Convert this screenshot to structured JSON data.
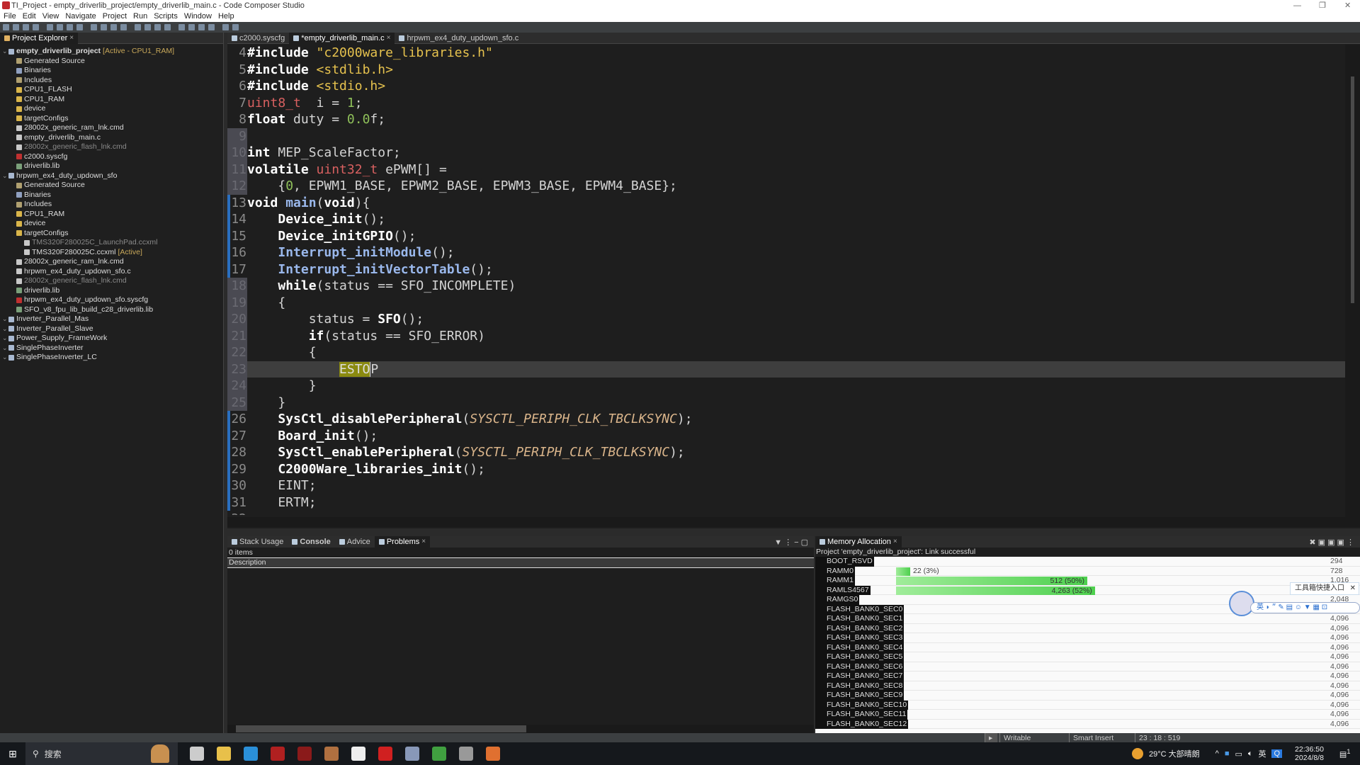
{
  "window": {
    "title": "TI_Project - empty_driverlib_project/empty_driverlib_main.c - Code Composer Studio"
  },
  "menu": [
    "File",
    "Edit",
    "View",
    "Navigate",
    "Project",
    "Run",
    "Scripts",
    "Window",
    "Help"
  ],
  "explorer": {
    "tab": "Project Explorer",
    "items": [
      {
        "label": "empty_driverlib_project",
        "lvl": 0,
        "icon": "proj",
        "active": "[Active - CPU1_RAM]",
        "bold": true
      },
      {
        "label": "Generated Source",
        "lvl": 1,
        "icon": "gen"
      },
      {
        "label": "Binaries",
        "lvl": 1,
        "icon": "bin"
      },
      {
        "label": "Includes",
        "lvl": 1,
        "icon": "gen"
      },
      {
        "label": "CPU1_FLASH",
        "lvl": 1,
        "icon": "folder"
      },
      {
        "label": "CPU1_RAM",
        "lvl": 1,
        "icon": "folder"
      },
      {
        "label": "device",
        "lvl": 1,
        "icon": "folder"
      },
      {
        "label": "targetConfigs",
        "lvl": 1,
        "icon": "folder"
      },
      {
        "label": "28002x_generic_ram_lnk.cmd",
        "lvl": 1,
        "icon": "file"
      },
      {
        "label": "empty_driverlib_main.c",
        "lvl": 1,
        "icon": "file"
      },
      {
        "label": "28002x_generic_flash_lnk.cmd",
        "lvl": 1,
        "icon": "file",
        "dim": true
      },
      {
        "label": "c2000.syscfg",
        "lvl": 1,
        "icon": "cfg"
      },
      {
        "label": "driverlib.lib",
        "lvl": 1,
        "icon": "lib"
      },
      {
        "label": "hrpwm_ex4_duty_updown_sfo",
        "lvl": 0,
        "icon": "proj"
      },
      {
        "label": "Generated Source",
        "lvl": 1,
        "icon": "gen"
      },
      {
        "label": "Binaries",
        "lvl": 1,
        "icon": "bin"
      },
      {
        "label": "Includes",
        "lvl": 1,
        "icon": "gen"
      },
      {
        "label": "CPU1_RAM",
        "lvl": 1,
        "icon": "folder"
      },
      {
        "label": "device",
        "lvl": 1,
        "icon": "folder"
      },
      {
        "label": "targetConfigs",
        "lvl": 1,
        "icon": "folder"
      },
      {
        "label": "TMS320F280025C_LaunchPad.ccxml",
        "lvl": 2,
        "icon": "file",
        "dim": true
      },
      {
        "label": "TMS320F280025C.ccxml",
        "lvl": 2,
        "icon": "file",
        "active": "[Active]"
      },
      {
        "label": "28002x_generic_ram_lnk.cmd",
        "lvl": 1,
        "icon": "file"
      },
      {
        "label": "hrpwm_ex4_duty_updown_sfo.c",
        "lvl": 1,
        "icon": "file"
      },
      {
        "label": "28002x_generic_flash_lnk.cmd",
        "lvl": 1,
        "icon": "file",
        "dim": true
      },
      {
        "label": "driverlib.lib",
        "lvl": 1,
        "icon": "lib"
      },
      {
        "label": "hrpwm_ex4_duty_updown_sfo.syscfg",
        "lvl": 1,
        "icon": "cfg"
      },
      {
        "label": "SFO_v8_fpu_lib_build_c28_driverlib.lib",
        "lvl": 1,
        "icon": "lib"
      },
      {
        "label": "Inverter_Parallel_Mas",
        "lvl": 0,
        "icon": "proj"
      },
      {
        "label": "Inverter_Parallel_Slave",
        "lvl": 0,
        "icon": "proj"
      },
      {
        "label": "Power_Supply_FrameWork",
        "lvl": 0,
        "icon": "proj"
      },
      {
        "label": "SinglePhaseInverter",
        "lvl": 0,
        "icon": "proj"
      },
      {
        "label": "SinglePhaseInverter_LC",
        "lvl": 0,
        "icon": "proj"
      }
    ]
  },
  "editor": {
    "tabs": [
      {
        "label": "c2000.syscfg"
      },
      {
        "label": "*empty_driverlib_main.c",
        "active": true
      },
      {
        "label": "hrpwm_ex4_duty_updown_sfo.c"
      }
    ],
    "lines": [
      {
        "n": "4",
        "t": [
          [
            "kw",
            "#include "
          ],
          [
            "str",
            "\"c2000ware_libraries.h\""
          ]
        ]
      },
      {
        "n": "5",
        "t": [
          [
            "kw",
            "#include "
          ],
          [
            "str",
            "<stdlib.h>"
          ]
        ]
      },
      {
        "n": "6",
        "t": [
          [
            "kw",
            "#include "
          ],
          [
            "str",
            "<stdio.h>"
          ]
        ]
      },
      {
        "n": "7",
        "t": [
          [
            "typ",
            "uint8_t"
          ],
          [
            "",
            "  i = "
          ],
          [
            "num2",
            "1"
          ],
          [
            "",
            ";"
          ]
        ]
      },
      {
        "n": "8",
        "t": [
          [
            "kw",
            "float"
          ],
          [
            "",
            " duty = "
          ],
          [
            "num2",
            "0.0"
          ],
          [
            "",
            "f;"
          ]
        ]
      },
      {
        "n": "9",
        "t": [],
        "qd": true
      },
      {
        "n": "10",
        "t": [
          [
            "kw",
            "int"
          ],
          [
            "",
            " MEP_ScaleFactor;"
          ]
        ],
        "qd": true
      },
      {
        "n": "11",
        "t": [
          [
            "kw",
            "volatile "
          ],
          [
            "typ",
            "uint32_t"
          ],
          [
            "",
            " ePWM[] ="
          ]
        ],
        "qd": true
      },
      {
        "n": "12",
        "t": [
          [
            "",
            "    {"
          ],
          [
            "num2",
            "0"
          ],
          [
            "",
            ", EPWM1_BASE, EPWM2_BASE, EPWM3_BASE, EPWM4_BASE};"
          ]
        ],
        "qd": true
      },
      {
        "n": "13",
        "t": [
          [
            "kw",
            "void "
          ],
          [
            "fn",
            "main"
          ],
          [
            "",
            "("
          ],
          [
            "kw",
            "void"
          ],
          [
            "",
            "){"
          ]
        ],
        "mod": true
      },
      {
        "n": "14",
        "t": [
          [
            "",
            "    "
          ],
          [
            "bf",
            "Device_init"
          ],
          [
            "",
            "();"
          ]
        ],
        "mod": true
      },
      {
        "n": "15",
        "t": [
          [
            "",
            "    "
          ],
          [
            "bf",
            "Device_initGPIO"
          ],
          [
            "",
            "();"
          ]
        ],
        "mod": true
      },
      {
        "n": "16",
        "t": [
          [
            "",
            "    "
          ],
          [
            "fn",
            "Interrupt_initModule"
          ],
          [
            "",
            "();"
          ]
        ],
        "mod": true
      },
      {
        "n": "17",
        "t": [
          [
            "",
            "    "
          ],
          [
            "fn",
            "Interrupt_initVectorTable"
          ],
          [
            "",
            "();"
          ]
        ],
        "mod": true
      },
      {
        "n": "18",
        "t": [
          [
            "",
            "    "
          ],
          [
            "kw",
            "while"
          ],
          [
            "",
            "(status == SFO_INCOMPLETE)"
          ]
        ],
        "qd": true
      },
      {
        "n": "19",
        "t": [
          [
            "",
            "    {"
          ]
        ],
        "qd": true
      },
      {
        "n": "20",
        "t": [
          [
            "",
            "        status = "
          ],
          [
            "bf",
            "SFO"
          ],
          [
            "",
            "();"
          ]
        ],
        "qd": true
      },
      {
        "n": "21",
        "t": [
          [
            "",
            "        "
          ],
          [
            "kw",
            "if"
          ],
          [
            "",
            "(status == SFO_ERROR)"
          ]
        ],
        "qd": true
      },
      {
        "n": "22",
        "t": [
          [
            "",
            "        {"
          ]
        ],
        "qd": true
      },
      {
        "n": "23",
        "t": [
          [
            "",
            "            "
          ],
          [
            "hl",
            "ESTO"
          ],
          [
            "caret",
            "P"
          ]
        ],
        "qd": true,
        "cur": true
      },
      {
        "n": "24",
        "t": [
          [
            "",
            "        }"
          ]
        ],
        "qd": true
      },
      {
        "n": "25",
        "t": [
          [
            "",
            "    }"
          ]
        ],
        "qd": true
      },
      {
        "n": "26",
        "t": [
          [
            "",
            "    "
          ],
          [
            "bf",
            "SysCtl_disablePeripheral"
          ],
          [
            "",
            "("
          ],
          [
            "cst",
            "SYSCTL_PERIPH_CLK_TBCLKSYNC"
          ],
          [
            "",
            ");"
          ]
        ],
        "mod": true
      },
      {
        "n": "27",
        "t": [
          [
            "",
            "    "
          ],
          [
            "bf",
            "Board_init"
          ],
          [
            "",
            "();"
          ]
        ],
        "mod": true
      },
      {
        "n": "28",
        "t": [
          [
            "",
            "    "
          ],
          [
            "bf",
            "SysCtl_enablePeripheral"
          ],
          [
            "",
            "("
          ],
          [
            "cst",
            "SYSCTL_PERIPH_CLK_TBCLKSYNC"
          ],
          [
            "",
            ");"
          ]
        ],
        "mod": true
      },
      {
        "n": "29",
        "t": [
          [
            "",
            "    "
          ],
          [
            "bf",
            "C2000Ware_libraries_init"
          ],
          [
            "",
            "();"
          ]
        ],
        "mod": true
      },
      {
        "n": "30",
        "t": [
          [
            "",
            "    EINT;"
          ]
        ],
        "mod": true
      },
      {
        "n": "31",
        "t": [
          [
            "",
            "    ERTM;"
          ]
        ],
        "mod": true
      },
      {
        "n": "32",
        "t": []
      }
    ]
  },
  "problems": {
    "tabs": [
      "Stack Usage",
      "Console",
      "Advice",
      "Problems"
    ],
    "count": "0 items",
    "column": "Description"
  },
  "memory": {
    "tab": "Memory Allocation",
    "status": "Project 'empty_driverlib_project': Link successful",
    "rows": [
      {
        "name": "BOOT_RSVD",
        "value": "294"
      },
      {
        "name": "RAMM0",
        "value": "728",
        "used": "22 (3%)",
        "pct": 3
      },
      {
        "name": "RAMM1",
        "value": "1,016",
        "used": "512 (50%)",
        "pct": 50
      },
      {
        "name": "RAMLS4567",
        "value": "2,048",
        "used": "4,263 (52%)",
        "pct": 52
      },
      {
        "name": "RAMGS0",
        "value": "2,048"
      },
      {
        "name": "FLASH_BANK0_SEC0",
        "value": "4,096"
      },
      {
        "name": "FLASH_BANK0_SEC1",
        "value": "4,096"
      },
      {
        "name": "FLASH_BANK0_SEC2",
        "value": "4,096"
      },
      {
        "name": "FLASH_BANK0_SEC3",
        "value": "4,096"
      },
      {
        "name": "FLASH_BANK0_SEC4",
        "value": "4,096"
      },
      {
        "name": "FLASH_BANK0_SEC5",
        "value": "4,096"
      },
      {
        "name": "FLASH_BANK0_SEC6",
        "value": "4,096"
      },
      {
        "name": "FLASH_BANK0_SEC7",
        "value": "4,096"
      },
      {
        "name": "FLASH_BANK0_SEC8",
        "value": "4,096"
      },
      {
        "name": "FLASH_BANK0_SEC9",
        "value": "4,096"
      },
      {
        "name": "FLASH_BANK0_SEC10",
        "value": "4,096"
      },
      {
        "name": "FLASH_BANK0_SEC11",
        "value": "4,096"
      },
      {
        "name": "FLASH_BANK0_SEC12",
        "value": "4,096"
      }
    ]
  },
  "ime": {
    "tooltip": "工具箱快捷入口",
    "lang": "英"
  },
  "status": {
    "mode": "Writable",
    "insert": "Smart Insert",
    "position": "23 : 18 : 519"
  },
  "taskbar": {
    "search": "搜索",
    "weather": "29°C 大部晴朗",
    "ime": "英",
    "time": "22:36:50",
    "date": "2024/8/8",
    "notifications": "1",
    "apps": [
      {
        "name": "task-view",
        "color": "#ccc"
      },
      {
        "name": "file-explorer",
        "color": "#e8c04a"
      },
      {
        "name": "edge",
        "color": "#2a8fd8"
      },
      {
        "name": "atk-xcom",
        "color": "#b02020"
      },
      {
        "name": "dice-app",
        "color": "#8a1a1a"
      },
      {
        "name": "bear-app",
        "color": "#b07040"
      },
      {
        "name": "wps-app",
        "color": "#eee"
      },
      {
        "name": "ccs-app",
        "color": "#d02020"
      },
      {
        "name": "camera-app",
        "color": "#8898b8"
      },
      {
        "name": "globe-app",
        "color": "#40a040"
      },
      {
        "name": "obs-app",
        "color": "#999"
      },
      {
        "name": "mic-app",
        "color": "#e07030"
      }
    ]
  }
}
